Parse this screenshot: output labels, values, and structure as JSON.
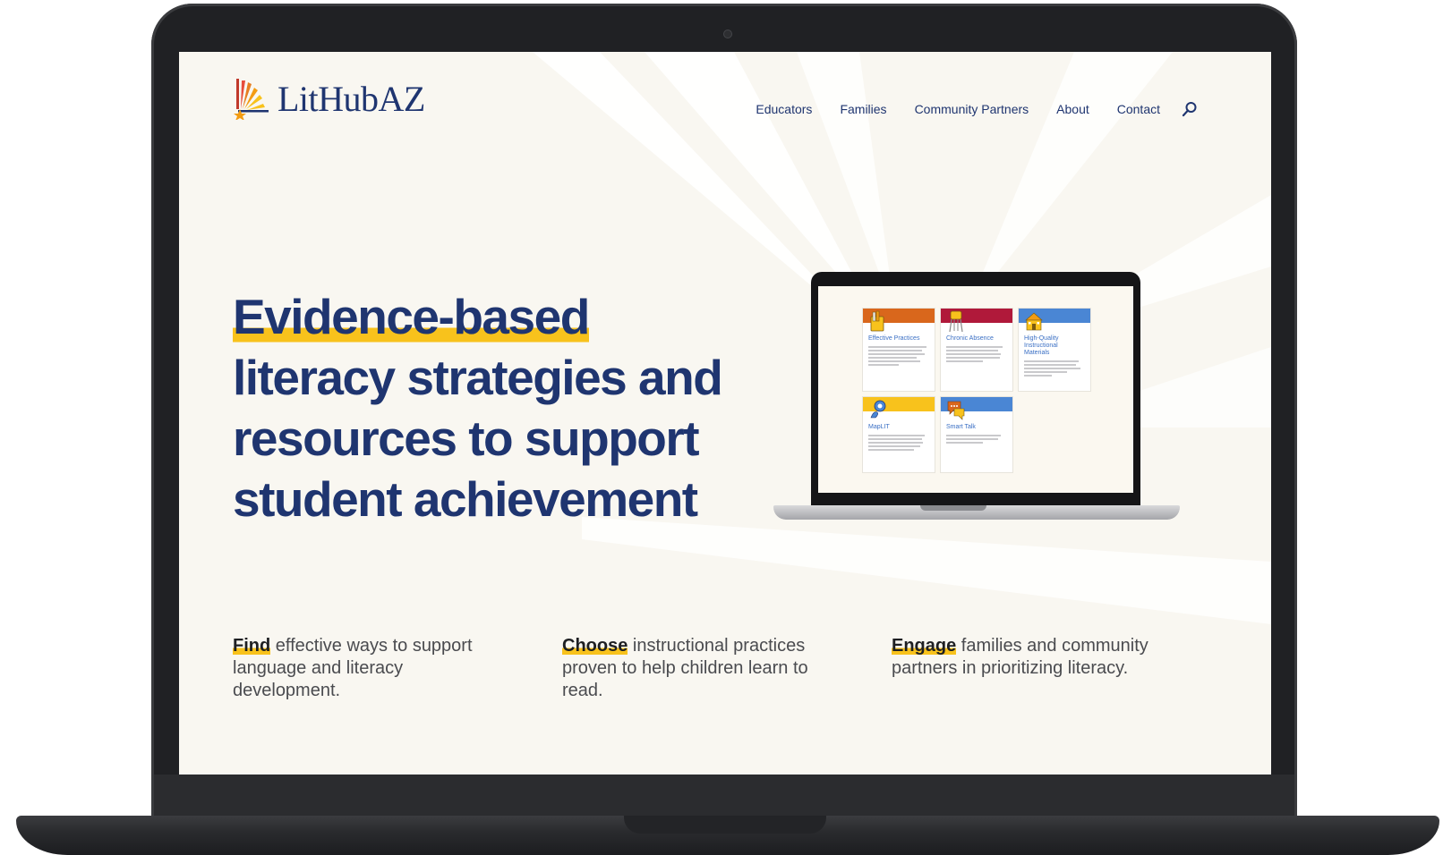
{
  "brand": {
    "name": "LitHubAZ"
  },
  "nav": {
    "items": [
      {
        "label": "Educators"
      },
      {
        "label": "Families"
      },
      {
        "label": "Community Partners"
      },
      {
        "label": "About"
      },
      {
        "label": "Contact"
      }
    ],
    "search_icon": "search-icon"
  },
  "hero": {
    "lines": [
      "Evidence-based",
      "literacy strategies and",
      "resources to support",
      "student achievement"
    ],
    "highlight_color": "#f8c21c",
    "text_color": "#1f3570"
  },
  "preview": {
    "cards": [
      {
        "title": "Effective Practices",
        "color": "#d9671c",
        "icon": "books-icon"
      },
      {
        "title": "Chronic Absence",
        "color": "#b0193a",
        "icon": "desk-icon"
      },
      {
        "title": "High-Quality Instructional Materials",
        "color": "#4a86d4",
        "icon": "school-icon"
      },
      {
        "title": "MapLIT",
        "color": "#f8c21c",
        "icon": "map-pin-icon"
      },
      {
        "title": "Smart Talk",
        "color": "#4a86d4",
        "icon": "chat-icon"
      }
    ]
  },
  "features": [
    {
      "key": "Find",
      "text": " effective ways to support language and literacy development."
    },
    {
      "key": "Choose",
      "text": " instructional practices proven to help children learn to read."
    },
    {
      "key": "Engage",
      "text": " families and community partners in prioritizing literacy."
    }
  ]
}
